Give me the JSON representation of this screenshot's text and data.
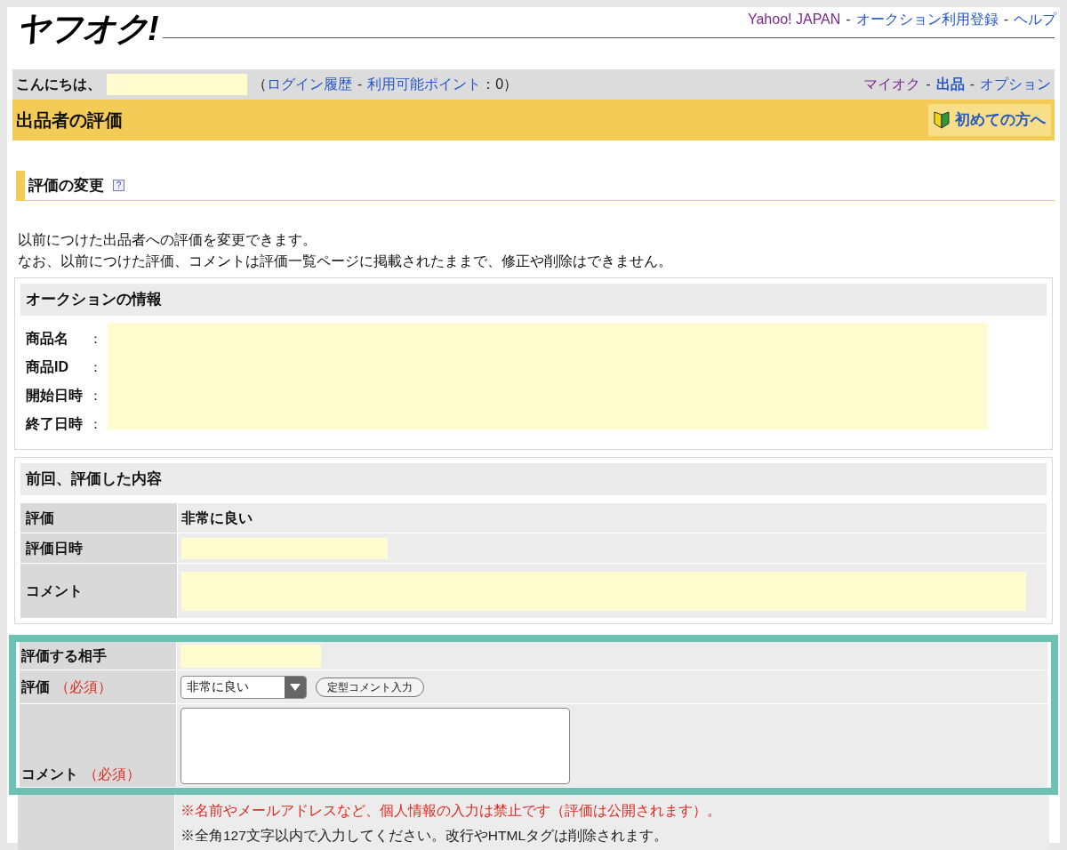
{
  "header": {
    "logo": "ヤフオク!",
    "links": [
      {
        "kind": "link",
        "text": "Yahoo! JAPAN",
        "visited": true,
        "bold": false
      },
      {
        "kind": "separator",
        "text": "-"
      },
      {
        "kind": "link",
        "text": "オークション利用登録",
        "visited": false,
        "bold": false
      },
      {
        "kind": "separator",
        "text": "-"
      },
      {
        "kind": "link",
        "text": "ヘルプ",
        "visited": false,
        "bold": false
      }
    ]
  },
  "greeting_bar": {
    "greeting": "こんにちは、",
    "left": [
      {
        "kind": "text",
        "text": "（"
      },
      {
        "kind": "link",
        "text": "ログイン履歴",
        "visited": false,
        "bold": false
      },
      {
        "kind": "separator",
        "text": "-"
      },
      {
        "kind": "link",
        "text": "利用可能ポイント",
        "visited": false,
        "bold": false
      },
      {
        "kind": "text",
        "text": "：0）"
      }
    ],
    "right": [
      {
        "kind": "link",
        "text": "マイオク",
        "visited": true,
        "bold": false
      },
      {
        "kind": "separator",
        "text": "-"
      },
      {
        "kind": "link",
        "text": "出品",
        "visited": false,
        "bold": true
      },
      {
        "kind": "separator",
        "text": "-"
      },
      {
        "kind": "link",
        "text": "オプション",
        "visited": false,
        "bold": false
      }
    ]
  },
  "title_bar": {
    "title": "出品者の評価",
    "beginner_button": "初めての方へ"
  },
  "section": {
    "heading": "評価の変更",
    "help": "?"
  },
  "intro": [
    "以前につけた出品者への評価を変更できます。",
    "なお、以前につけた評価、コメントは評価一覧ページに掲載されたままで、修正や削除はできません。"
  ],
  "auction_info": {
    "title": "オークションの情報",
    "rows": [
      {
        "label": "商品名",
        "colon": "："
      },
      {
        "label": "商品ID",
        "colon": "："
      },
      {
        "label": "開始日時",
        "colon": "："
      },
      {
        "label": "終了日時",
        "colon": "："
      }
    ]
  },
  "previous": {
    "title": "前回、評価した内容",
    "rows": [
      {
        "label": "評価",
        "kind": "text",
        "value": "非常に良い"
      },
      {
        "label": "評価日時",
        "kind": "redacted"
      },
      {
        "label": "コメント",
        "kind": "redacted_tall"
      }
    ]
  },
  "form": {
    "rows": [
      {
        "label": "評価する相手",
        "kind": "redacted"
      },
      {
        "label": "評価",
        "required": "（必須）",
        "kind": "select",
        "value": "非常に良い",
        "button": "定型コメント入力"
      },
      {
        "label": "コメント",
        "required": "（必須）",
        "kind": "textarea"
      }
    ],
    "warning": "※名前やメールアドレスなど、個人情報の入力は禁止です（評価は公開されます）。",
    "note": "※全角127文字以内で入力してください。改行やHTMLタグは削除されます。"
  }
}
